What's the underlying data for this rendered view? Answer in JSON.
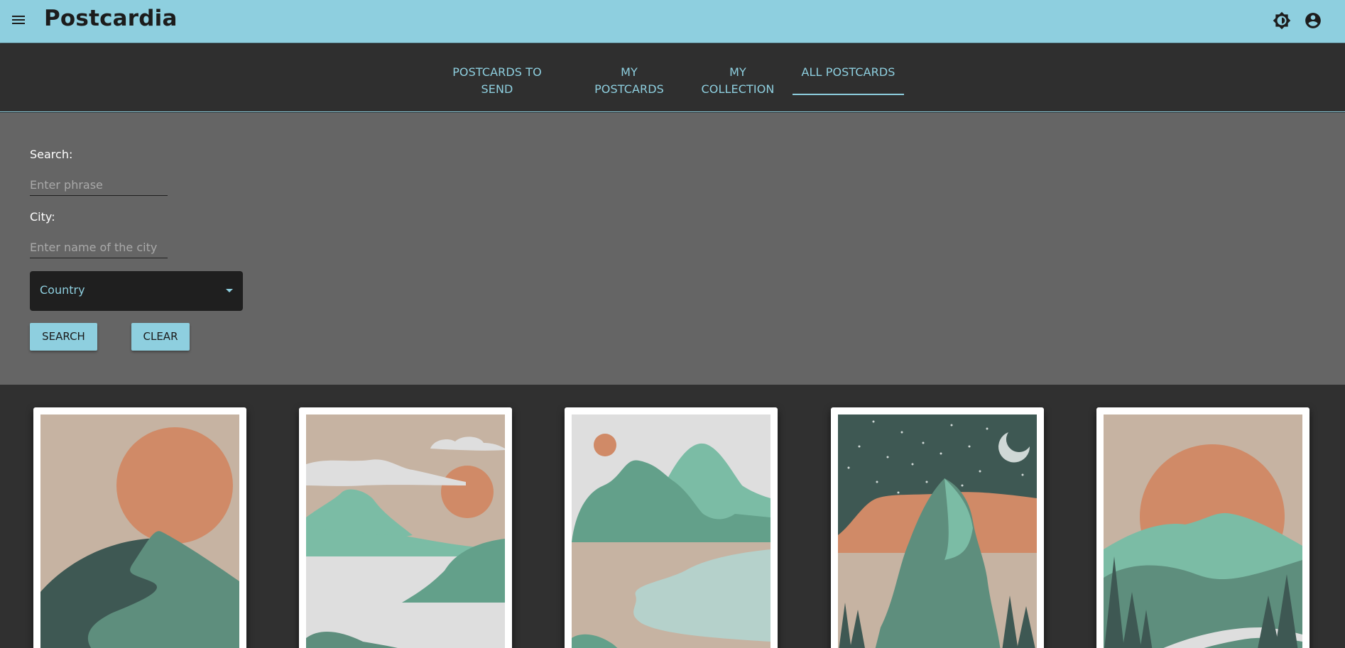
{
  "app": {
    "title": "Postcardia"
  },
  "header": {
    "menu_icon": "menu-icon",
    "theme_icon": "brightness-icon",
    "account_icon": "account-circle-icon"
  },
  "tabs": [
    {
      "label": "POSTCARDS TO SEND",
      "active": false
    },
    {
      "label": "MY POSTCARDS",
      "active": false
    },
    {
      "label": "MY COLLECTION",
      "active": false
    },
    {
      "label": "ALL POSTCARDS",
      "active": true
    }
  ],
  "filters": {
    "search_label": "Search:",
    "search_placeholder": "Enter phrase",
    "city_label": "City:",
    "city_placeholder": "Enter name of the city",
    "country_select": "Country",
    "search_button": "SEARCH",
    "clear_button": "CLEAR"
  },
  "postcards": [
    {
      "scene": "sun-over-dark-hills"
    },
    {
      "scene": "clouds-sun-lake"
    },
    {
      "scene": "hills-beach-river"
    },
    {
      "scene": "night-mountain-moon"
    },
    {
      "scene": "sunrise-valley-forest"
    }
  ],
  "colors": {
    "accent": "#8ecfdf",
    "app_bar": "#8ecfdf",
    "tab_bar": "#2f2f2f",
    "filter_panel": "#656565",
    "page_bg": "#303030",
    "beige": "#c6b3a2",
    "orange": "#d08a67",
    "green": "#5e8e7d",
    "light_green": "#7bbca5",
    "dark_green": "#3e5853"
  }
}
